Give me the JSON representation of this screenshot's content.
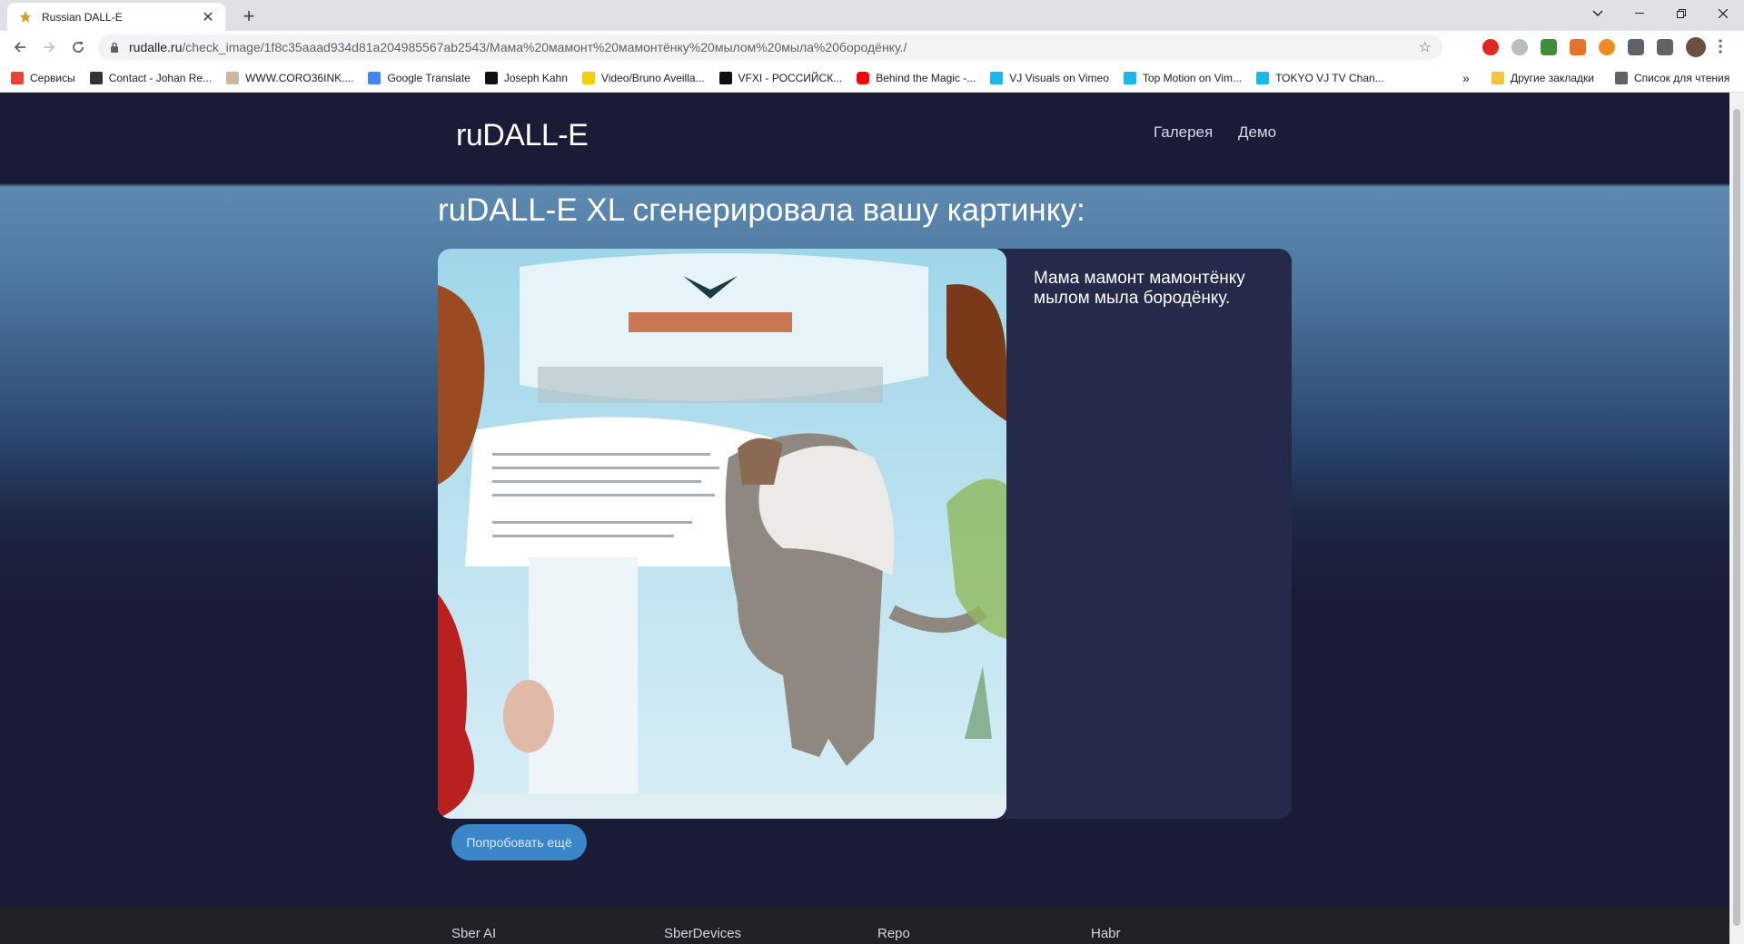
{
  "browser": {
    "tab_title": "Russian DALL-E",
    "url_host": "rudalle.ru",
    "url_path": "/check_image/1f8c35aaad934d81a204985567ab2543/Мама%20мамонт%20мамонтёнку%20мылом%20мыла%20бородёнку./",
    "new_tab": "+",
    "close": "✕",
    "star": "☆",
    "bookmarks": [
      {
        "label": "Сервисы",
        "color": "#ea4335"
      },
      {
        "label": "Contact - Johan Re...",
        "color": "#333333"
      },
      {
        "label": "WWW.CORO36INK....",
        "color": "#c8b8a0"
      },
      {
        "label": "Google Translate",
        "color": "#4285f4"
      },
      {
        "label": "Joseph Kahn",
        "color": "#111111"
      },
      {
        "label": "Video/Bruno Aveilla...",
        "color": "#f4d000"
      },
      {
        "label": "VFXI - РОССИЙСК...",
        "color": "#111111"
      },
      {
        "label": "Behind the Magic -...",
        "color": "#ff0000"
      },
      {
        "label": "VJ Visuals on Vimeo",
        "color": "#1ab7ea"
      },
      {
        "label": "Top Motion on Vim...",
        "color": "#1ab7ea"
      },
      {
        "label": "TOKYO VJ TV Chan...",
        "color": "#1ab7ea"
      }
    ],
    "more_bookmarks": "»",
    "other_bookmarks": "Другие закладки",
    "reading_list": "Список для чтения"
  },
  "site": {
    "logo": "ruDALL-E",
    "nav": {
      "gallery": "Галерея",
      "demo": "Демо"
    },
    "result_title": "ruDALL-E XL сгенерировала вашу картинку:",
    "caption": "Мама мамонт мамонтёнку мылом мыла бородёнку.",
    "try_again": "Попробовать ещё",
    "footer": {
      "sber_ai": "Sber AI",
      "sberdevices": "SberDevices",
      "repo": "Repo",
      "habr": "Habr"
    }
  },
  "colors": {
    "page_bg": "#1a1c37",
    "card_bg": "#25294a",
    "accent_button": "#3a86c8"
  }
}
